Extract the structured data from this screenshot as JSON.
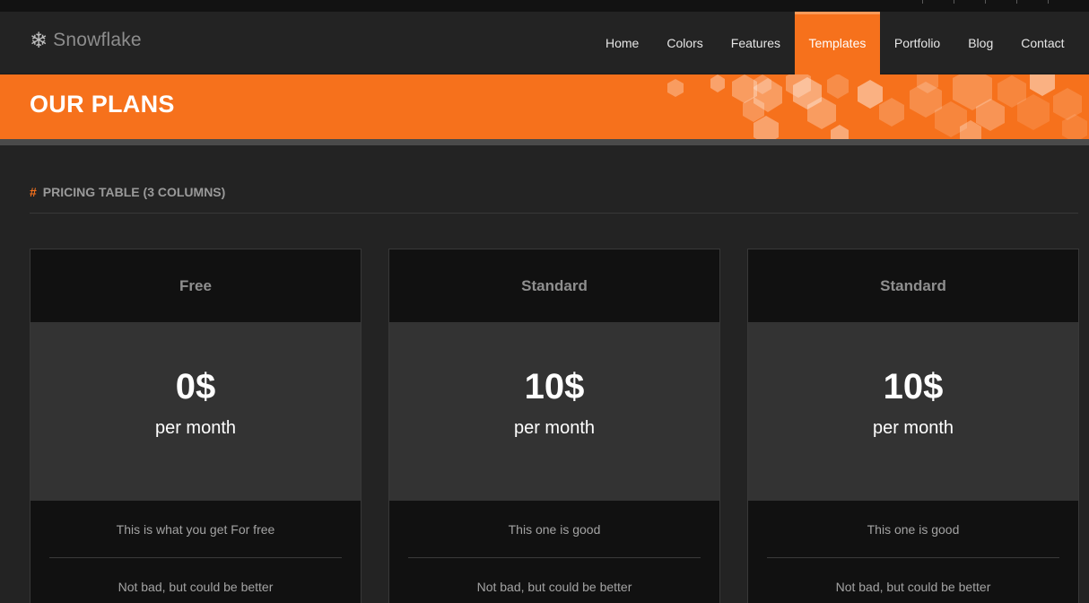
{
  "brand": {
    "name": "Snowflake",
    "icon": "snowflake-icon"
  },
  "nav": {
    "items": [
      {
        "label": "Home",
        "active": false
      },
      {
        "label": "Colors",
        "active": false
      },
      {
        "label": "Features",
        "active": false
      },
      {
        "label": "Templates",
        "active": true
      },
      {
        "label": "Portfolio",
        "active": false
      },
      {
        "label": "Blog",
        "active": false
      },
      {
        "label": "Contact",
        "active": false
      }
    ]
  },
  "banner": {
    "title": "OUR PLANS"
  },
  "section": {
    "hash": "#",
    "title": "PRICING TABLE (3 COLUMNS)"
  },
  "plans": [
    {
      "name": "Free",
      "price": "0$",
      "period": "per month",
      "features": [
        "This is what you get For free",
        "Not bad, but could be better"
      ]
    },
    {
      "name": "Standard",
      "price": "10$",
      "period": "per month",
      "features": [
        "This one is good",
        "Not bad, but could be better"
      ]
    },
    {
      "name": "Standard",
      "price": "10$",
      "period": "per month",
      "features": [
        "This one is good",
        "Not bad, but could be better"
      ]
    }
  ],
  "colors": {
    "accent": "#f6711c",
    "background": "#232323",
    "panel_dark": "#111111",
    "panel_mid": "#333333"
  }
}
